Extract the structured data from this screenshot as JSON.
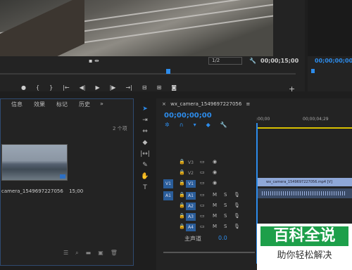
{
  "monitor": {
    "fraction": "1/2",
    "timecode": "00;00;15;00",
    "right_timecode": "00;00;00;00",
    "transport_icons": [
      "marker-icon",
      "in-icon",
      "out-icon",
      "go-in-icon",
      "step-back-icon",
      "play-icon",
      "step-forward-icon",
      "go-out-icon",
      "insert-icon",
      "overwrite-icon",
      "camera-icon"
    ],
    "plus": "+"
  },
  "project": {
    "tabs": [
      "信息",
      "效果",
      "标记",
      "历史"
    ],
    "tab_more": "»",
    "count": "2 个项",
    "clip_name": "camera_1549697227056",
    "clip_duration": "15;00"
  },
  "timeline": {
    "title": "wx_camera_1549697227056",
    "menu": "≡",
    "timecode": "00;00;00;00",
    "ruler": [
      ":00;00",
      "00;00;04;29"
    ],
    "video_tracks": [
      {
        "label": "V3",
        "source": ""
      },
      {
        "label": "V2",
        "source": ""
      },
      {
        "label": "V1",
        "source": "V1"
      }
    ],
    "audio_tracks": [
      {
        "label": "A1",
        "source": "A1"
      },
      {
        "label": "A2",
        "source": ""
      },
      {
        "label": "A3",
        "source": ""
      },
      {
        "label": "A4",
        "source": ""
      }
    ],
    "clip_label": "wx_camera_1549697227056.mp4 [V]",
    "master_label": "主声道",
    "master_value": "0.0",
    "m_label": "M",
    "s_label": "S"
  },
  "watermark": {
    "title": "百科全说",
    "subtitle": "助你轻松解决"
  }
}
